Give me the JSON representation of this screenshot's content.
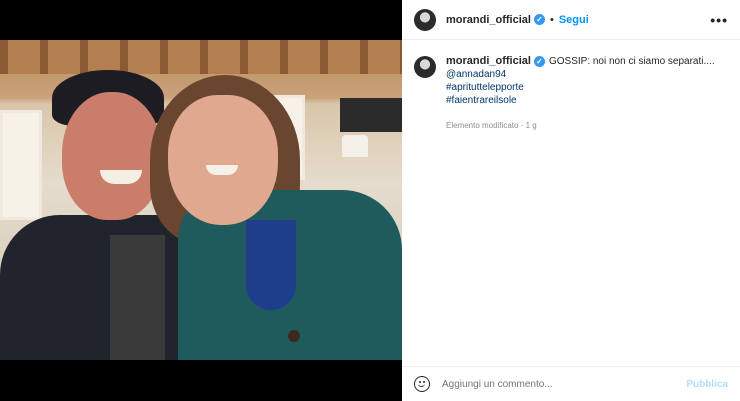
{
  "post": {
    "username": "morandi_official",
    "follow_label": "Segui",
    "separator": "•",
    "more_label": "•••",
    "verified_glyph": "✓"
  },
  "caption": {
    "username": "morandi_official",
    "text": "GOSSIP: noi non ci siamo separati....",
    "mention": "@annadan94",
    "hashtags": [
      "#aprituttelepporte",
      "#faientrareilsole"
    ],
    "meta": "Elemento modificato · 1 g"
  },
  "comment": {
    "placeholder": "Aggiungi un commento...",
    "publish_label": "Pubblica"
  },
  "colors": {
    "accent": "#0095f6",
    "link": "#00376b",
    "muted": "#8e8e8e"
  }
}
